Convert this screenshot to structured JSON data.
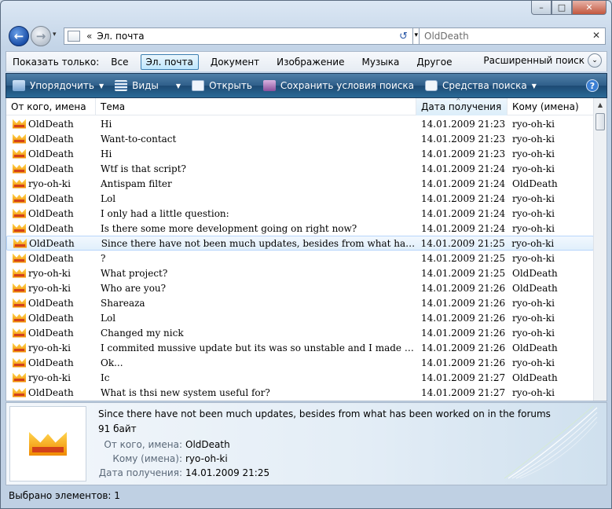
{
  "window": {
    "caption_min": "–",
    "caption_max": "□",
    "caption_close": "✕"
  },
  "nav": {
    "back": "←",
    "forward": "→",
    "history": "▾",
    "address_sep": "«",
    "address_crumb": "Эл. почта",
    "address_dd": "▾",
    "refresh": "↺",
    "search_value": "OldDeath",
    "search_clear": "✕"
  },
  "filter": {
    "label": "Показать только:",
    "items": [
      "Все",
      "Эл. почта",
      "Документ",
      "Изображение",
      "Музыка",
      "Другое"
    ],
    "active": "Эл. почта",
    "advanced": "Расширенный поиск",
    "advanced_chev": "⌄"
  },
  "commands": {
    "organize": "Упорядочить",
    "views": "Виды",
    "open": "Открыть",
    "save_search": "Сохранить условия поиска",
    "search_tools": "Средства поиска",
    "arrow": "▼",
    "help": "?"
  },
  "columns": [
    "От кого, имена",
    "Тема",
    "Дата получения",
    "Кому (имена)"
  ],
  "rows": [
    {
      "from": "OldDeath",
      "subject": "Hi",
      "date": "14.01.2009 21:23",
      "to": "ryo-oh-ki"
    },
    {
      "from": "OldDeath",
      "subject": "Want-to-contact",
      "date": "14.01.2009 21:23",
      "to": "ryo-oh-ki"
    },
    {
      "from": "OldDeath",
      "subject": "Hi",
      "date": "14.01.2009 21:23",
      "to": "ryo-oh-ki"
    },
    {
      "from": "OldDeath",
      "subject": "Wtf is that script?",
      "date": "14.01.2009 21:24",
      "to": "ryo-oh-ki"
    },
    {
      "from": "ryo-oh-ki",
      "subject": "Antispam filter",
      "date": "14.01.2009 21:24",
      "to": "OldDeath"
    },
    {
      "from": "OldDeath",
      "subject": "Lol",
      "date": "14.01.2009 21:24",
      "to": "ryo-oh-ki"
    },
    {
      "from": "OldDeath",
      "subject": "I only had a little question:",
      "date": "14.01.2009 21:24",
      "to": "ryo-oh-ki"
    },
    {
      "from": "OldDeath",
      "subject": "Is there some more development going on right now?",
      "date": "14.01.2009 21:24",
      "to": "ryo-oh-ki"
    },
    {
      "from": "OldDeath",
      "subject": "Since there have not been much updates, besides from what has been w...",
      "date": "14.01.2009 21:25",
      "to": "ryo-oh-ki"
    },
    {
      "from": "OldDeath",
      "subject": "?",
      "date": "14.01.2009 21:25",
      "to": "ryo-oh-ki"
    },
    {
      "from": "ryo-oh-ki",
      "subject": "What project?",
      "date": "14.01.2009 21:25",
      "to": "OldDeath"
    },
    {
      "from": "ryo-oh-ki",
      "subject": "Who are you?",
      "date": "14.01.2009 21:26",
      "to": "OldDeath"
    },
    {
      "from": "OldDeath",
      "subject": "Shareaza",
      "date": "14.01.2009 21:26",
      "to": "ryo-oh-ki"
    },
    {
      "from": "OldDeath",
      "subject": "Lol",
      "date": "14.01.2009 21:26",
      "to": "ryo-oh-ki"
    },
    {
      "from": "OldDeath",
      "subject": "Changed my nick",
      "date": "14.01.2009 21:26",
      "to": "ryo-oh-ki"
    },
    {
      "from": "ryo-oh-ki",
      "subject": "I commited mussive update but its was so unstable and I made branch \"...",
      "date": "14.01.2009 21:26",
      "to": "OldDeath"
    },
    {
      "from": "OldDeath",
      "subject": "Ok...",
      "date": "14.01.2009 21:26",
      "to": "ryo-oh-ki"
    },
    {
      "from": "ryo-oh-ki",
      "subject": "Ic",
      "date": "14.01.2009 21:27",
      "to": "OldDeath"
    },
    {
      "from": "OldDeath",
      "subject": "What is thsi new system useful for?",
      "date": "14.01.2009 21:27",
      "to": "ryo-oh-ki"
    }
  ],
  "selected_row": 8,
  "details": {
    "title": "Since there have not been much updates, besides from what has been worked on in the forums",
    "size": "91 байт",
    "from_label": "От кого, имена:",
    "from_value": "OldDeath",
    "to_label": "Кому (имена):",
    "to_value": "ryo-oh-ki",
    "date_label": "Дата получения:",
    "date_value": "14.01.2009 21:25"
  },
  "status": "Выбрано элементов: 1",
  "colors": {
    "accent": "#2f5f8a",
    "selection": "#e1effb",
    "icon_orange": "#f08a00"
  }
}
